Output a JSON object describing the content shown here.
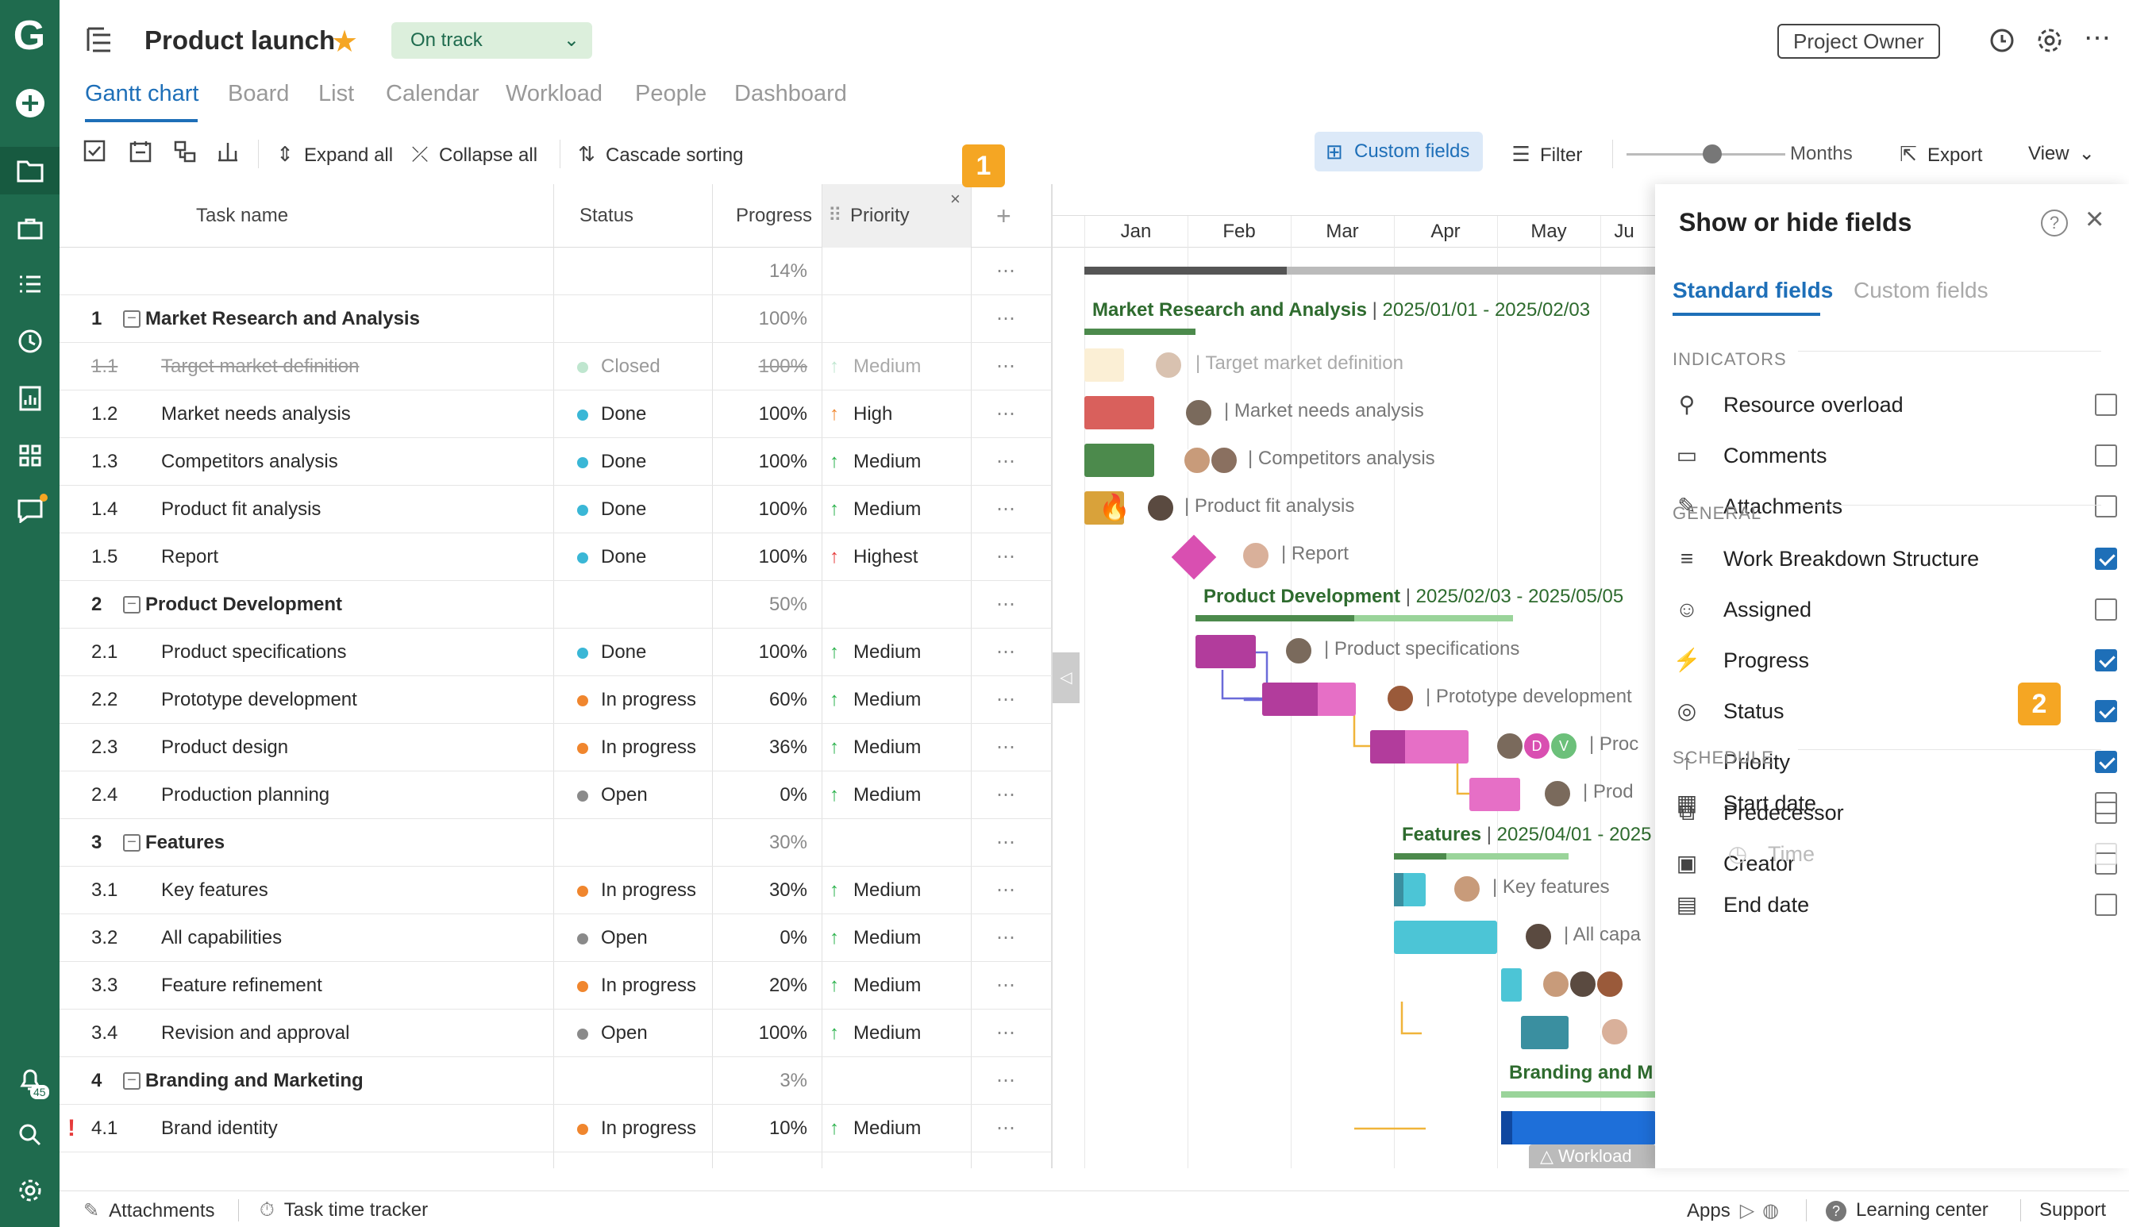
{
  "app": {
    "logo": "G"
  },
  "header": {
    "title": "Product launch",
    "status": "On track",
    "owner_label": "Project Owner",
    "tabs": [
      "Gantt chart",
      "Board",
      "List",
      "Calendar",
      "Workload",
      "People",
      "Dashboard"
    ]
  },
  "toolbar": {
    "expand_all": "Expand all",
    "collapse_all": "Collapse all",
    "cascade_sorting": "Cascade sorting",
    "custom_fields": "Custom fields",
    "filter": "Filter",
    "zoom_unit": "Months",
    "export": "Export",
    "view": "View"
  },
  "grid": {
    "columns": {
      "task_name": "Task name",
      "status": "Status",
      "progress": "Progress",
      "priority": "Priority"
    },
    "total_progress": "14%",
    "rows": [
      {
        "wbs": "1",
        "name": "Market Research and Analysis",
        "status": "",
        "progress": "100%",
        "priority": "",
        "group": true
      },
      {
        "wbs": "1.1",
        "name": "Target market definition",
        "status": "Closed",
        "progress": "100%",
        "priority": "Medium",
        "closed": true
      },
      {
        "wbs": "1.2",
        "name": "Market needs analysis",
        "status": "Done",
        "progress": "100%",
        "priority": "High"
      },
      {
        "wbs": "1.3",
        "name": "Competitors analysis",
        "status": "Done",
        "progress": "100%",
        "priority": "Medium"
      },
      {
        "wbs": "1.4",
        "name": "Product fit analysis",
        "status": "Done",
        "progress": "100%",
        "priority": "Medium"
      },
      {
        "wbs": "1.5",
        "name": "Report",
        "status": "Done",
        "progress": "100%",
        "priority": "Highest"
      },
      {
        "wbs": "2",
        "name": "Product Development",
        "status": "",
        "progress": "50%",
        "priority": "",
        "group": true
      },
      {
        "wbs": "2.1",
        "name": "Product specifications",
        "status": "Done",
        "progress": "100%",
        "priority": "Medium"
      },
      {
        "wbs": "2.2",
        "name": "Prototype development",
        "status": "In progress",
        "progress": "60%",
        "priority": "Medium"
      },
      {
        "wbs": "2.3",
        "name": "Product design",
        "status": "In progress",
        "progress": "36%",
        "priority": "Medium"
      },
      {
        "wbs": "2.4",
        "name": "Production planning",
        "status": "Open",
        "progress": "0%",
        "priority": "Medium"
      },
      {
        "wbs": "3",
        "name": "Features",
        "status": "",
        "progress": "30%",
        "priority": "",
        "group": true
      },
      {
        "wbs": "3.1",
        "name": "Key features",
        "status": "In progress",
        "progress": "30%",
        "priority": "Medium"
      },
      {
        "wbs": "3.2",
        "name": "All capabilities",
        "status": "Open",
        "progress": "0%",
        "priority": "Medium"
      },
      {
        "wbs": "3.3",
        "name": "Feature refinement",
        "status": "In progress",
        "progress": "20%",
        "priority": "Medium"
      },
      {
        "wbs": "3.4",
        "name": "Revision and approval",
        "status": "Open",
        "progress": "100%",
        "priority": "Medium"
      },
      {
        "wbs": "4",
        "name": "Branding and Marketing",
        "status": "",
        "progress": "3%",
        "priority": "",
        "group": true
      },
      {
        "wbs": "4.1",
        "name": "Brand identity",
        "status": "In progress",
        "progress": "10%",
        "priority": "Medium",
        "flag": true
      }
    ],
    "colors": {
      "Done": "#3ab7d6",
      "In progress": "#f0862e",
      "Open": "#8a8a8a",
      "Closed": "#bfe6cf",
      "High": "#f0862e",
      "Highest": "#e63b3b",
      "Medium": "#2bb24c"
    }
  },
  "gantt": {
    "months": [
      "Jan",
      "Feb",
      "Mar",
      "Apr",
      "May",
      "Ju"
    ],
    "summaries": [
      {
        "name": "Market Research and Analysis",
        "dates": "2025/01/01 - 2025/02/03"
      },
      {
        "name": "Product Development",
        "dates": "2025/02/03 - 2025/05/05"
      },
      {
        "name": "Features",
        "dates": "2025/04/01 - 2025"
      },
      {
        "name": "Branding and M",
        "dates": ""
      }
    ],
    "labels": [
      "Target market definition",
      "Market needs analysis",
      "Competitors analysis",
      "Product fit analysis",
      "Report",
      "Product specifications",
      "Prototype development",
      "Proc",
      "Prod",
      "Key features",
      "All capa"
    ],
    "avatar_initials": [
      "D",
      "V"
    ],
    "workload": "Workload"
  },
  "panel": {
    "title": "Show or hide fields",
    "tabs": [
      "Standard fields",
      "Custom fields"
    ],
    "sections": [
      {
        "title": "INDICATORS",
        "items": [
          {
            "label": "Resource overload",
            "icon": "person-alert-icon",
            "checked": false
          },
          {
            "label": "Comments",
            "icon": "comment-icon",
            "checked": false
          },
          {
            "label": "Attachments",
            "icon": "paperclip-icon",
            "checked": false
          }
        ]
      },
      {
        "title": "GENERAL",
        "items": [
          {
            "label": "Work Breakdown Structure",
            "icon": "wbs-icon",
            "checked": true
          },
          {
            "label": "Assigned",
            "icon": "person-icon",
            "checked": false
          },
          {
            "label": "Progress",
            "icon": "progress-icon",
            "checked": true
          },
          {
            "label": "Status",
            "icon": "status-icon",
            "checked": true
          },
          {
            "label": "Priority",
            "icon": "priority-icon",
            "checked": true
          },
          {
            "label": "Predecessor",
            "icon": "predecessor-icon",
            "checked": false
          },
          {
            "label": "Creator",
            "icon": "creator-icon",
            "checked": false
          }
        ]
      },
      {
        "title": "SCHEDULE",
        "items": [
          {
            "label": "Start date",
            "icon": "calendar-start-icon",
            "checked": false
          },
          {
            "label": "Time",
            "icon": "clock-icon",
            "checked": false,
            "muted": true
          },
          {
            "label": "End date",
            "icon": "calendar-end-icon",
            "checked": false
          }
        ]
      }
    ]
  },
  "steps": {
    "one": "1",
    "two": "2"
  },
  "footer": {
    "attachments": "Attachments",
    "time_tracker": "Task time tracker",
    "apps": "Apps",
    "learning_center": "Learning center",
    "support": "Support"
  },
  "notifications": {
    "count": "45"
  }
}
